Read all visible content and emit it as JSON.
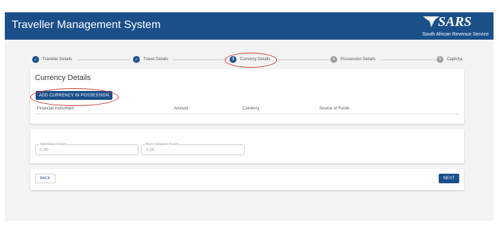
{
  "header": {
    "title": "Traveller Management System",
    "brand_logo_text": "SARS",
    "brand_subtitle": "South African Revenue Service",
    "background": "#1b4f8a"
  },
  "stepper": {
    "steps": [
      {
        "number": "1",
        "label": "Traveller Details",
        "state": "complete"
      },
      {
        "number": "2",
        "label": "Travel Details",
        "state": "complete"
      },
      {
        "number": "3",
        "label": "Currency Details",
        "state": "active"
      },
      {
        "number": "4",
        "label": "Possession Details",
        "state": "pending"
      },
      {
        "number": "5",
        "label": "Captcha",
        "state": "pending"
      }
    ]
  },
  "currency_card": {
    "title": "Currency Details",
    "add_button_label": "ADD CURRENCY IN POSSESSION",
    "columns": [
      "Financial Instrument",
      "Amount",
      "Currency",
      "Source of Funds"
    ],
    "rows": []
  },
  "rand_card": {
    "total_rand_amount": {
      "label": "Total Rand Amount",
      "value": "0.00"
    },
    "rand_allowance_excess": {
      "label": "Rand Allowance Excess",
      "value": "0.00"
    }
  },
  "navigation": {
    "back_label": "BACK",
    "next_label": "NEXT"
  },
  "colors": {
    "accent": "#1b4f8a",
    "annotation": "#d32f2f",
    "pending_step": "#9e9e9e",
    "page_background": "#f3f3f3"
  }
}
